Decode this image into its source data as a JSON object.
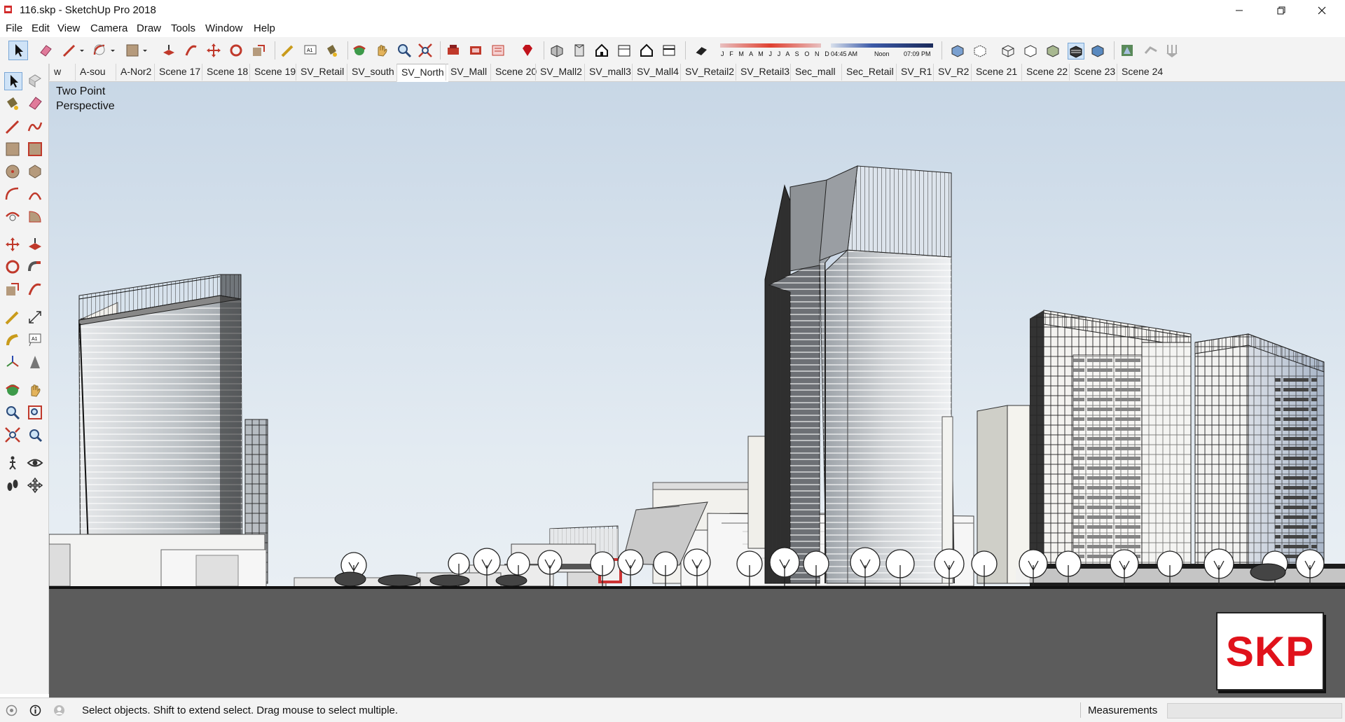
{
  "window": {
    "title": "116.skp - SketchUp Pro 2018",
    "controls": [
      "minimize",
      "restore",
      "close"
    ]
  },
  "menu": [
    "File",
    "Edit",
    "View",
    "Camera",
    "Draw",
    "Tools",
    "Window",
    "Help"
  ],
  "shadow_settings": {
    "months": "J F M A M J J A S O N D",
    "time_start": "04:45 AM",
    "time_mid": "Noon",
    "time_end": "07:09 PM"
  },
  "scenes": {
    "tabs": [
      "w",
      "A-sou",
      "A-Nor2",
      "Scene 17",
      "Scene 18",
      "Scene 19",
      "SV_Retail",
      "SV_south",
      "SV_North",
      "SV_Mall",
      "Scene 20",
      "SV_Mall2",
      "SV_mall3",
      "SV_Mall4",
      "SV_Retail2",
      "SV_Retail3",
      "Sec_mall",
      "Sec_Retail",
      "SV_R1",
      "SV_R2",
      "Scene 21",
      "Scene 22",
      "Scene 23",
      "Scene 24"
    ],
    "active": "SV_North"
  },
  "viewport": {
    "camera_label_line1": "Two Point",
    "camera_label_line2": "Perspective",
    "logo_text": "SKP"
  },
  "statusbar": {
    "hint": "Select objects. Shift to extend select. Drag mouse to select multiple.",
    "measurements_label": "Measurements",
    "measurements_value": ""
  },
  "colors": {
    "sky_top": "#c8d7e6",
    "ground": "#5c5c5c",
    "logo_red": "#e0121b",
    "chrome": "#f3f3f3"
  }
}
